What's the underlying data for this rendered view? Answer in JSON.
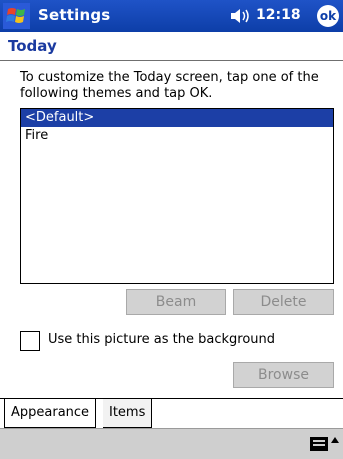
{
  "titlebar": {
    "app_title": "Settings",
    "time": "12:18",
    "ok_label": "ok"
  },
  "page": {
    "heading": "Today",
    "instructions": "To customize the Today screen, tap one of the following themes and tap OK."
  },
  "themes": {
    "items": [
      {
        "label": "<Default>",
        "selected": true
      },
      {
        "label": "Fire",
        "selected": false
      }
    ]
  },
  "buttons": {
    "beam": "Beam",
    "delete": "Delete",
    "browse": "Browse"
  },
  "background_option": {
    "label": "Use this picture as the background",
    "checked": false
  },
  "tabs": [
    {
      "label": "Appearance",
      "active": true
    },
    {
      "label": "Items",
      "active": false
    }
  ],
  "colors": {
    "titlebar": "#0d3ea8",
    "selection": "#1c3fa6",
    "heading": "#1a3aa0"
  }
}
